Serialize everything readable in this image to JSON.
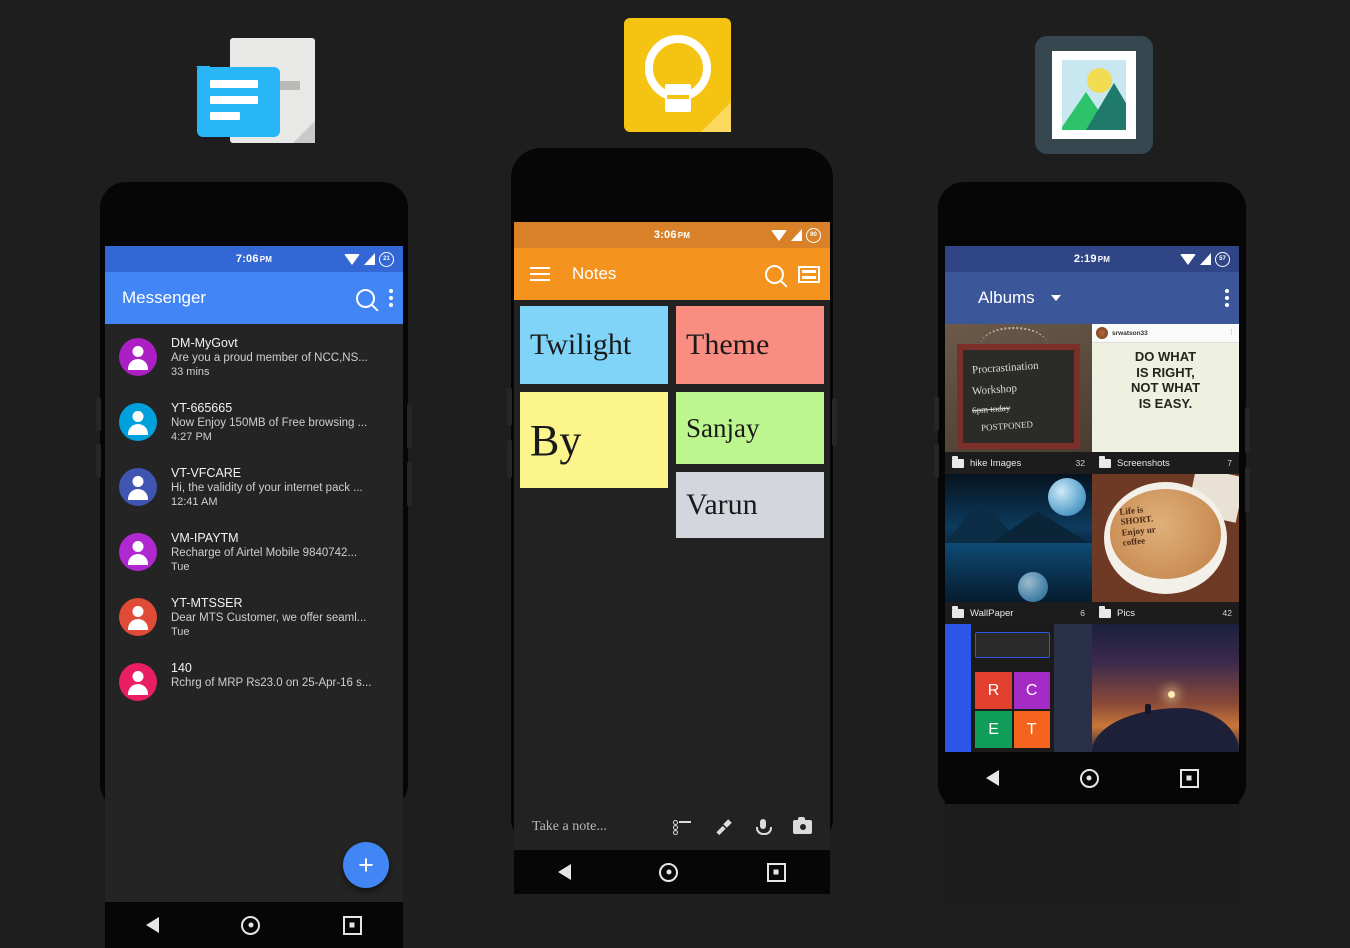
{
  "page": {
    "background": "#1e1e1e"
  },
  "icons": {
    "messages": {
      "name": "messages-app-icon"
    },
    "keep": {
      "name": "google-keep-app-icon"
    },
    "gallery": {
      "name": "gallery-app-icon"
    }
  },
  "phone_messenger": {
    "status": {
      "time": "7:06",
      "meridiem": "PM",
      "battery": "21"
    },
    "appbar": {
      "title": "Messenger"
    },
    "accent": "#4285f4",
    "conversations": [
      {
        "name": "DM-MyGovt",
        "preview": "Are you a proud member of NCC,NS...",
        "time": "33 mins",
        "color": "#ab1fc4"
      },
      {
        "name": "YT-665665",
        "preview": "Now Enjoy 150MB of Free browsing ...",
        "time": "4:27 PM",
        "color": "#00a0dc"
      },
      {
        "name": "VT-VFCARE",
        "preview": "Hi, the validity of your internet pack ...",
        "time": "12:41 AM",
        "color": "#4054b2"
      },
      {
        "name": "VM-IPAYTM",
        "preview": "Recharge of Airtel Mobile 9840742...",
        "time": "Tue",
        "color": "#b028d0"
      },
      {
        "name": "YT-MTSSER",
        "preview": "Dear MTS Customer, we offer seaml...",
        "time": "Tue",
        "color": "#e04b38"
      },
      {
        "name": "140",
        "preview": "Rchrg of MRP Rs23.0 on 25-Apr-16 s...",
        "time": "",
        "color": "#e91e63"
      }
    ],
    "fab_label": "+"
  },
  "phone_notes": {
    "status": {
      "time": "3:06",
      "meridiem": "PM",
      "battery": "90"
    },
    "appbar": {
      "title": "Notes"
    },
    "accent": "#f4941f",
    "notes": [
      {
        "text": "Twilight",
        "color": "#7fd4f7",
        "col": 0
      },
      {
        "text": "By",
        "color": "#fbf58b",
        "col": 0
      },
      {
        "text": "Theme",
        "color": "#fa8d82",
        "col": 1
      },
      {
        "text": "Sanjay",
        "color": "#bdf58f",
        "col": 1
      },
      {
        "text": "Varun",
        "color": "#d3d7dd",
        "col": 1
      }
    ],
    "composer": {
      "placeholder": "Take a note..."
    }
  },
  "phone_gallery": {
    "status": {
      "time": "2:19",
      "meridiem": "PM",
      "battery": "57"
    },
    "appbar": {
      "title": "Albums"
    },
    "accent": "#3b5699",
    "albums": [
      {
        "name": "hike Images",
        "count": "32"
      },
      {
        "name": "Screenshots",
        "count": "7"
      },
      {
        "name": "WallPaper",
        "count": "6"
      },
      {
        "name": "Pics",
        "count": "42"
      }
    ],
    "thumbs": {
      "chalk": {
        "l1": "Procrastination",
        "l2": "Workshop",
        "l3": "6pm  today",
        "l4": "POSTPONED"
      },
      "instagram": {
        "user": "srwatson33",
        "quote_l1": "DO WHAT",
        "quote_l2": "IS RIGHT,",
        "quote_l3": "NOT WHAT",
        "quote_l4": "IS EASY."
      },
      "coffee": {
        "l1": "Life is",
        "l2": "SHORT.",
        "l3": "Enjoy ur",
        "l4": "coffee"
      },
      "dialer": {
        "t1": "R",
        "t2": "C",
        "t3": "E",
        "t4": "T"
      }
    }
  }
}
